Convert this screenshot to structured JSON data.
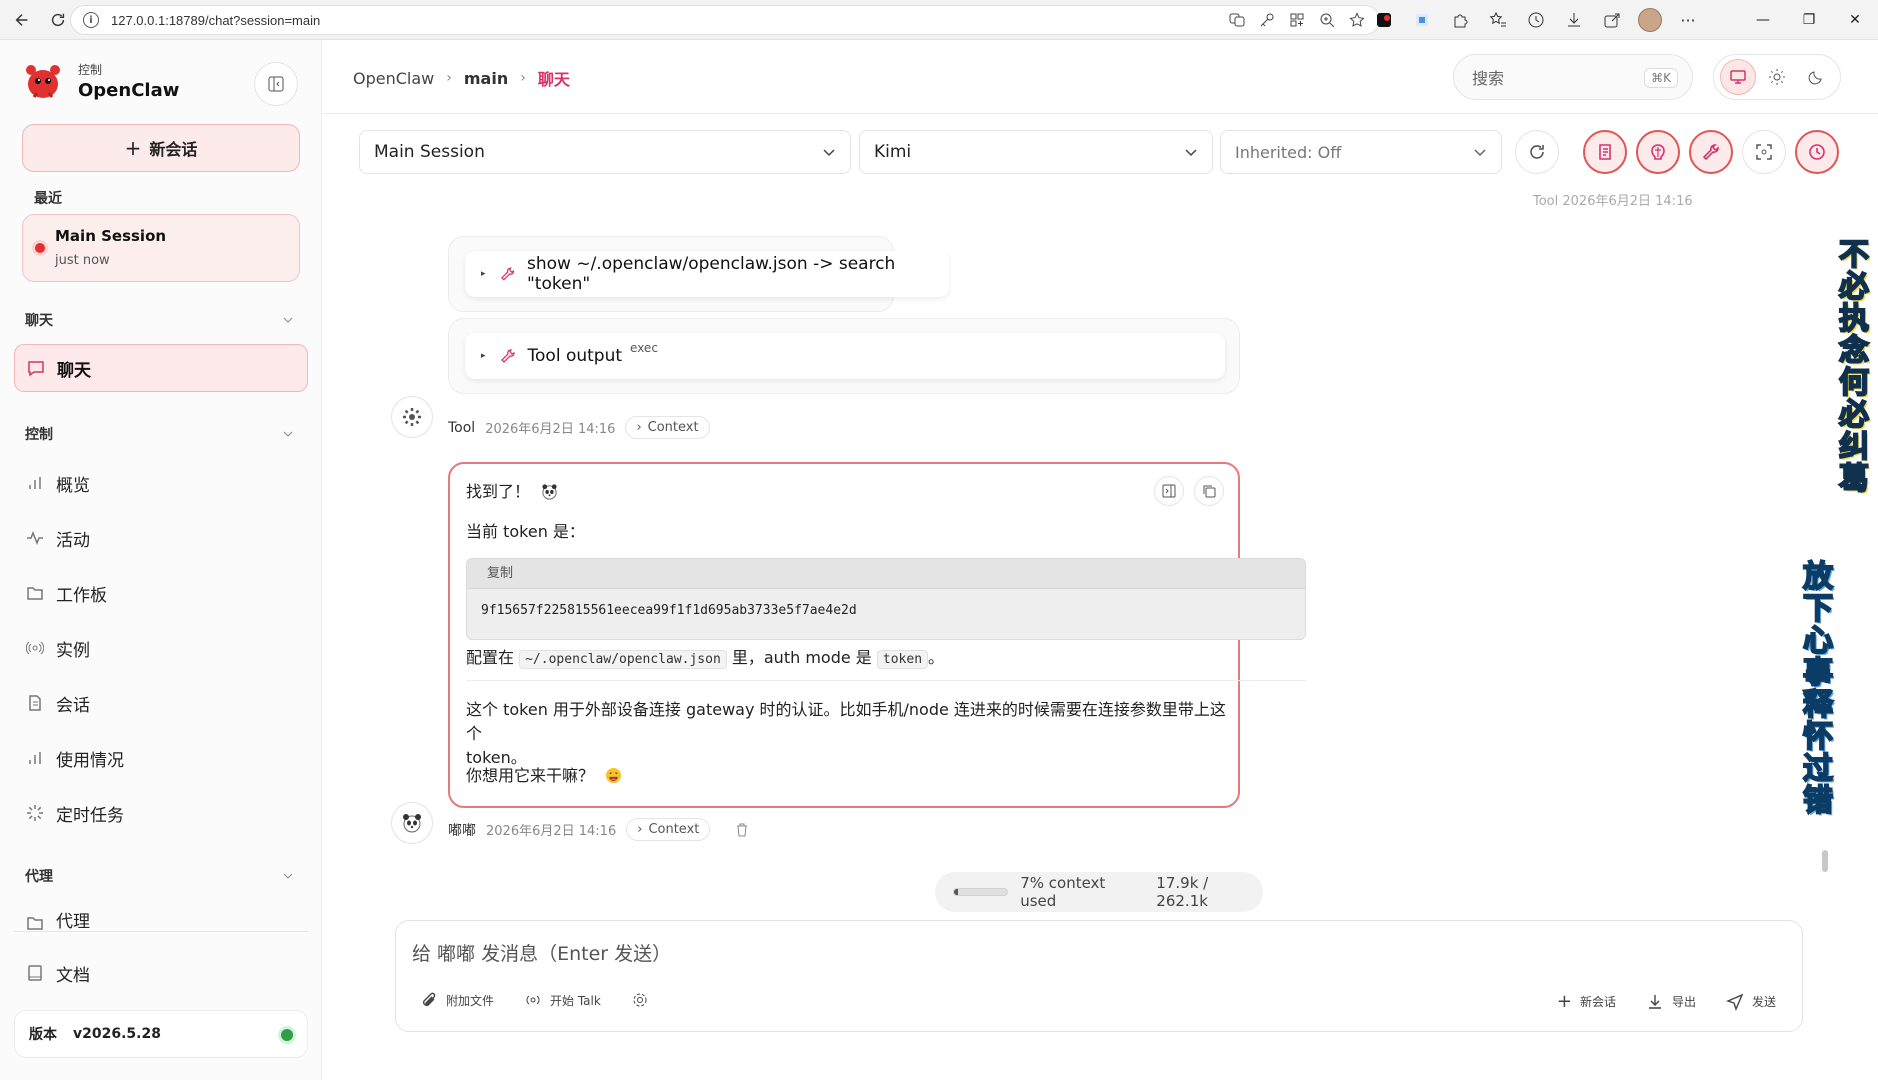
{
  "browser": {
    "url": "127.0.0.1:18789/chat?session=main"
  },
  "sidebar": {
    "brand_sub": "控制",
    "brand_name": "OpenClaw",
    "new_chat_label": "新会话",
    "recent_label": "最近",
    "recent_session": {
      "title": "Main Session",
      "time": "just now"
    },
    "section_chat": "聊天",
    "chat_item": "聊天",
    "section_control": "控制",
    "control_items": [
      "概览",
      "活动",
      "工作板",
      "实例",
      "会话",
      "使用情况",
      "定时任务"
    ],
    "section_agent": "代理",
    "agent_item": "代理",
    "docs_item": "文档",
    "version_label": "版本",
    "version_value": "v2026.5.28",
    "status_color": "#2f9e44"
  },
  "header": {
    "breadcrumb": [
      "OpenClaw",
      "main",
      "聊天"
    ],
    "search_placeholder": "搜索",
    "search_shortcut": "⌘K"
  },
  "toolbar": {
    "session_select": "Main Session",
    "model_select": "Kimi",
    "inherited_select": "Inherited: Off"
  },
  "chat": {
    "faded_top": "Tool  2026年6月2日 14:16",
    "tool_call": "show ~/.openclaw/openclaw.json -> search \"token\"",
    "tool_output_label": "Tool output",
    "tool_output_tag": "exec",
    "tool_meta": {
      "sender": "Tool",
      "time": "2026年6月2日 14:16",
      "context": "Context"
    },
    "reply": {
      "line1": "找到了！",
      "line2": "当前 token 是：",
      "copy_label": "复制",
      "token": "9f15657f225815561eecea99f1f1d695ab3733e5f7ae4e2d",
      "config_pre": "配置在",
      "config_path": "~/.openclaw/openclaw.json",
      "config_mid": "里，auth mode 是",
      "config_mode": "token",
      "config_end": "。",
      "para1": "这个 token 用于外部设备连接 gateway 时的认证。比如手机/node 连进来的时候需要在连接参数里带上这个",
      "para1_cont": "token。",
      "para2": "你想用它来干嘛？"
    },
    "reply_meta": {
      "sender": "嘟嘟",
      "time": "2026年6月2日 14:16",
      "context": "Context"
    },
    "context_usage": {
      "percent_label": "7% context used",
      "tokens": "17.9k / 262.1k",
      "fraction": 0.07
    }
  },
  "composer": {
    "placeholder": "给 嘟嘟 发消息（Enter 发送）",
    "attach": "附加文件",
    "talk": "开始 Talk",
    "new_chat": "新会话",
    "export": "导出",
    "send": "发送"
  },
  "decor": {
    "callig_1": "不必执念何必纠葛",
    "callig_2": "放下心事释怀过错"
  },
  "colors": {
    "accent": "#e05555",
    "accent_bg": "#fdeaea",
    "breadcrumb_current": "#d6336c"
  }
}
